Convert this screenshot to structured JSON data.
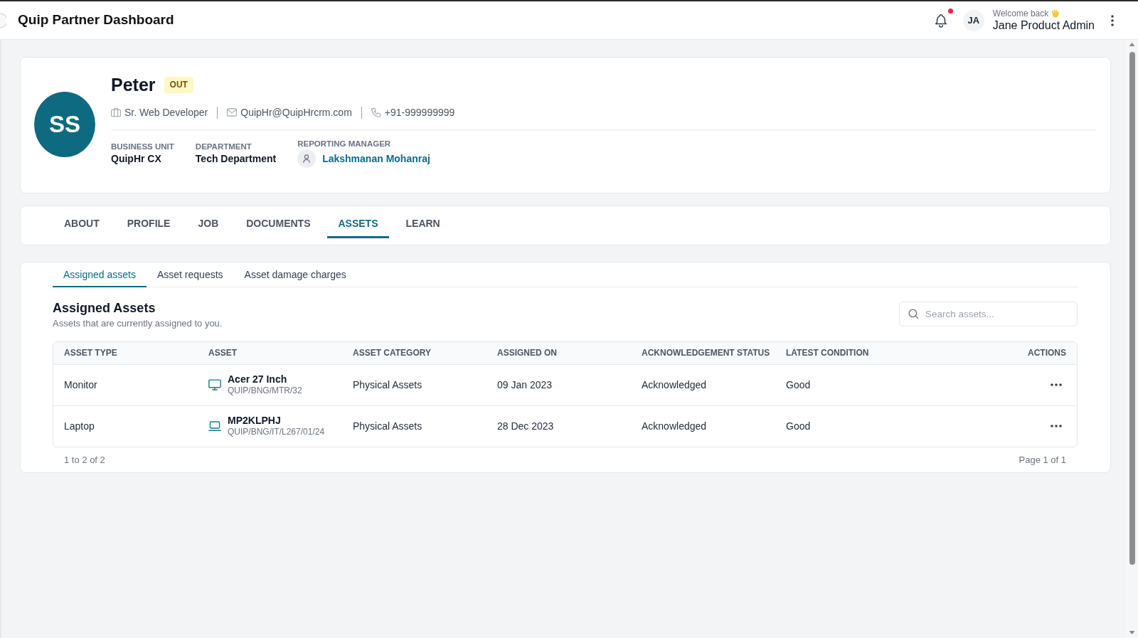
{
  "header": {
    "title": "Quip Partner Dashboard",
    "notifications": {
      "unread": true
    },
    "user": {
      "initials": "JA",
      "greeting": "Welcome back",
      "name": "Jane Product Admin"
    }
  },
  "profile": {
    "initials": "SS",
    "name": "Peter",
    "status_badge": "OUT",
    "contact": [
      {
        "kind": "role",
        "text": "Sr. Web Developer"
      },
      {
        "kind": "email",
        "text": "QuipHr@QuipHrcrm.com"
      },
      {
        "kind": "phone",
        "text": "+91-999999999"
      }
    ],
    "details": [
      {
        "kind": "text",
        "label": "BUSINESS UNIT",
        "value": "QuipHr CX"
      },
      {
        "kind": "text",
        "label": "DEPARTMENT",
        "value": "Tech Department"
      },
      {
        "kind": "person",
        "label": "REPORTING MANAGER",
        "value": "Lakshmanan Mohanraj"
      }
    ]
  },
  "tabs": [
    {
      "label": "ABOUT",
      "selected": false
    },
    {
      "label": "PROFILE",
      "selected": false
    },
    {
      "label": "JOB",
      "selected": false
    },
    {
      "label": "DOCUMENTS",
      "selected": false
    },
    {
      "label": "ASSETS",
      "selected": true
    },
    {
      "label": "LEARN",
      "selected": false
    }
  ],
  "subtabs": [
    {
      "label": "Assigned assets",
      "selected": true
    },
    {
      "label": "Asset requests",
      "selected": false
    },
    {
      "label": "Asset damage charges",
      "selected": false
    }
  ],
  "assets_section": {
    "title": "Assigned Assets",
    "subtitle": "Assets that are currently assigned to you.",
    "search": {
      "placeholder": "Search assets..."
    },
    "table": {
      "columns": [
        "ASSET TYPE",
        "ASSET",
        "ASSET CATEGORY",
        "ASSIGNED ON",
        "ACKNOWLEDGEMENT STATUS",
        "LATEST CONDITION",
        "ACTIONS"
      ],
      "rows": [
        {
          "asset_type": "Monitor",
          "asset": {
            "kind": "monitor",
            "name": "Acer 27 Inch",
            "code": "QUIP/BNG/MTR/32"
          },
          "asset_category": "Physical Assets",
          "assigned_on": "09 Jan 2023",
          "acknowledgement_status": "Acknowledged",
          "latest_condition": "Good"
        },
        {
          "asset_type": "Laptop",
          "asset": {
            "kind": "laptop",
            "name": "MP2KLPHJ",
            "code": "QUIP/BNG/IT/L267/01/24"
          },
          "asset_category": "Physical Assets",
          "assigned_on": "28 Dec 2023",
          "acknowledgement_status": "Acknowledged",
          "latest_condition": "Good"
        }
      ]
    },
    "footer": {
      "range": "1 to 2 of 2",
      "page": "Page 1 of 1"
    }
  }
}
